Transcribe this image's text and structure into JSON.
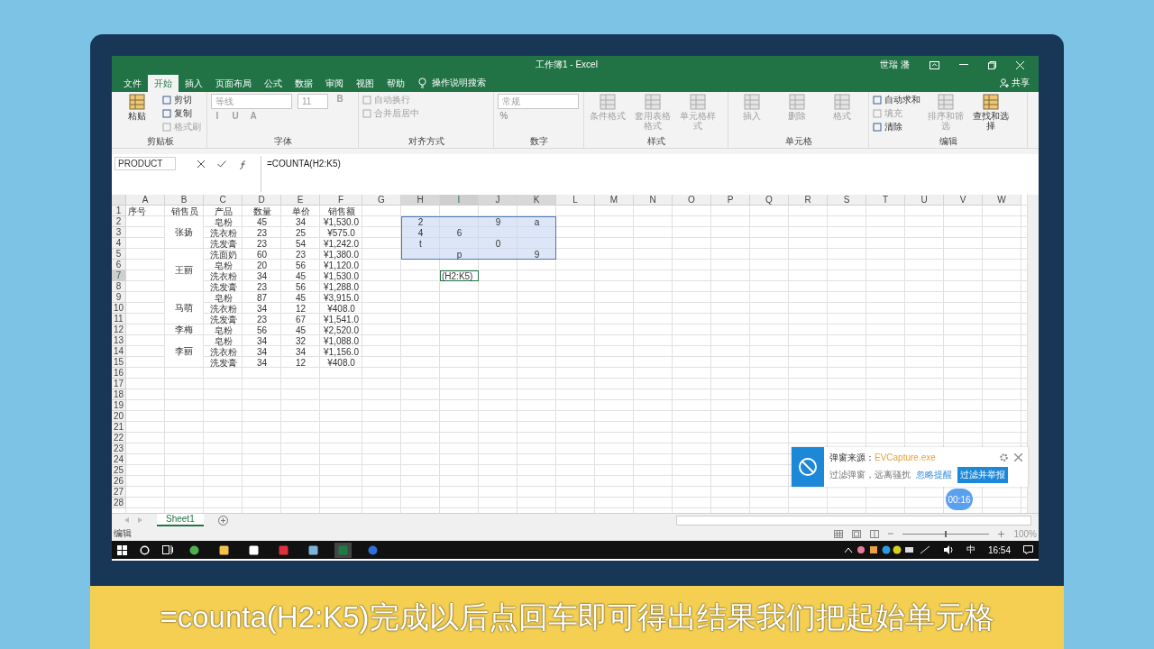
{
  "window": {
    "title": "工作簿1 - Excel",
    "user": "世瑞 潘",
    "share": "共享"
  },
  "ribbon_tabs": [
    {
      "label": "文件",
      "selected": false
    },
    {
      "label": "开始",
      "selected": true
    },
    {
      "label": "插入",
      "selected": false
    },
    {
      "label": "页面布局",
      "selected": false
    },
    {
      "label": "公式",
      "selected": false
    },
    {
      "label": "数据",
      "selected": false
    },
    {
      "label": "审阅",
      "selected": false
    },
    {
      "label": "视图",
      "selected": false
    },
    {
      "label": "帮助",
      "selected": false
    }
  ],
  "tell_me": "操作说明搜索",
  "ribbon_groups": [
    {
      "label": "剪贴板",
      "items": [
        {
          "kind": "large",
          "label": "粘贴",
          "disabled": false
        },
        {
          "kind": "small",
          "label": "剪切",
          "disabled": false
        },
        {
          "kind": "small",
          "label": "复制",
          "disabled": false
        },
        {
          "kind": "small",
          "label": "格式刷",
          "disabled": true
        }
      ]
    },
    {
      "label": "字体",
      "items": [
        {
          "kind": "combo",
          "label": "等线",
          "disabled": true
        },
        {
          "kind": "combo",
          "label": "11",
          "disabled": true
        },
        {
          "kind": "glyph",
          "label": "B",
          "disabled": true
        },
        {
          "kind": "glyph",
          "label": "I",
          "disabled": true
        },
        {
          "kind": "glyph",
          "label": "U",
          "disabled": true
        },
        {
          "kind": "glyph",
          "label": "A",
          "disabled": true
        }
      ]
    },
    {
      "label": "对齐方式",
      "items": [
        {
          "kind": "small",
          "label": "自动换行",
          "disabled": true
        },
        {
          "kind": "small",
          "label": "合并后居中",
          "disabled": true
        }
      ]
    },
    {
      "label": "数字",
      "items": [
        {
          "kind": "combo",
          "label": "常规",
          "disabled": true
        },
        {
          "kind": "glyph",
          "label": "%",
          "disabled": true
        }
      ]
    },
    {
      "label": "样式",
      "items": [
        {
          "kind": "large",
          "label": "条件格式",
          "disabled": true
        },
        {
          "kind": "large",
          "label": "套用表格格式",
          "disabled": true
        },
        {
          "kind": "large",
          "label": "单元格样式",
          "disabled": true
        }
      ]
    },
    {
      "label": "单元格",
      "items": [
        {
          "kind": "large",
          "label": "插入",
          "disabled": true
        },
        {
          "kind": "large",
          "label": "删除",
          "disabled": true
        },
        {
          "kind": "large",
          "label": "格式",
          "disabled": true
        }
      ]
    },
    {
      "label": "编辑",
      "items": [
        {
          "kind": "small",
          "label": "自动求和",
          "disabled": false
        },
        {
          "kind": "small",
          "label": "填充",
          "disabled": true
        },
        {
          "kind": "small",
          "label": "清除",
          "disabled": false
        },
        {
          "kind": "large",
          "label": "排序和筛选",
          "disabled": true
        },
        {
          "kind": "large",
          "label": "查找和选择",
          "disabled": false
        }
      ]
    }
  ],
  "formula_bar": {
    "name_box": "PRODUCT",
    "formula": "=COUNTA(H2:K5)"
  },
  "sheet": {
    "columns": [
      "A",
      "B",
      "C",
      "D",
      "E",
      "F",
      "G",
      "H",
      "I",
      "J",
      "K",
      "L",
      "M",
      "N",
      "O",
      "P",
      "Q",
      "R",
      "S",
      "T",
      "U",
      "V",
      "W"
    ],
    "row_numbers": [
      "1",
      "2",
      "3",
      "4",
      "5",
      "6",
      "7",
      "8",
      "9",
      "10",
      "11",
      "12",
      "13",
      "14",
      "15",
      "16",
      "17",
      "18",
      "19",
      "20",
      "21",
      "22",
      "23",
      "24",
      "25",
      "26",
      "27",
      "28"
    ],
    "header": [
      "序号",
      "销售员",
      "产品",
      "数量",
      "单价",
      "销售额"
    ],
    "groups": [
      {
        "seller": "张扬",
        "items": [
          {
            "product": "皂粉",
            "qty": "45",
            "price": "34",
            "amount": "¥1,530.0"
          },
          {
            "product": "洗衣粉",
            "qty": "23",
            "price": "25",
            "amount": "¥575.0"
          },
          {
            "product": "洗发膏",
            "qty": "23",
            "price": "54",
            "amount": "¥1,242.0"
          }
        ]
      },
      {
        "seller": "王丽",
        "items": [
          {
            "product": "洗面奶",
            "qty": "60",
            "price": "23",
            "amount": "¥1,380.0"
          },
          {
            "product": "皂粉",
            "qty": "20",
            "price": "56",
            "amount": "¥1,120.0"
          },
          {
            "product": "洗衣粉",
            "qty": "34",
            "price": "45",
            "amount": "¥1,530.0"
          },
          {
            "product": "洗发膏",
            "qty": "23",
            "price": "56",
            "amount": "¥1,288.0"
          }
        ]
      },
      {
        "seller": "马萌",
        "items": [
          {
            "product": "皂粉",
            "qty": "87",
            "price": "45",
            "amount": "¥3,915.0"
          },
          {
            "product": "洗衣粉",
            "qty": "34",
            "price": "12",
            "amount": "¥408.0"
          },
          {
            "product": "洗发膏",
            "qty": "23",
            "price": "67",
            "amount": "¥1,541.0"
          }
        ]
      },
      {
        "seller": "李梅",
        "items": [
          {
            "product": "皂粉",
            "qty": "56",
            "price": "45",
            "amount": "¥2,520.0"
          }
        ]
      },
      {
        "seller": "李丽",
        "items": [
          {
            "product": "皂粉",
            "qty": "34",
            "price": "32",
            "amount": "¥1,088.0"
          },
          {
            "product": "洗衣粉",
            "qty": "34",
            "price": "34",
            "amount": "¥1,156.0"
          },
          {
            "product": "洗发膏",
            "qty": "34",
            "price": "12",
            "amount": "¥408.0"
          }
        ]
      }
    ],
    "selection_block": [
      [
        {
          "kind": "value",
          "text": "2"
        },
        {
          "kind": "empty"
        },
        {
          "kind": "value",
          "text": "9"
        },
        {
          "kind": "value",
          "text": "a"
        }
      ],
      [
        {
          "kind": "value",
          "text": "4"
        },
        {
          "kind": "value",
          "text": "6"
        },
        {
          "kind": "empty"
        },
        {
          "kind": "empty"
        }
      ],
      [
        {
          "kind": "value",
          "text": "t"
        },
        {
          "kind": "empty"
        },
        {
          "kind": "value",
          "text": "0"
        },
        {
          "kind": "empty"
        }
      ],
      [
        {
          "kind": "empty"
        },
        {
          "kind": "value",
          "text": "p"
        },
        {
          "kind": "empty"
        },
        {
          "kind": "value",
          "text": "9"
        }
      ]
    ],
    "active_cell_text": "(H2:K5)"
  },
  "sheet_tabs": [
    {
      "label": "Sheet1",
      "selected": true
    }
  ],
  "status_bar": {
    "mode": "编辑",
    "zoom": "100%",
    "zoom_slider": {
      "level": 0.5
    }
  },
  "popup": {
    "source_label": "弹窗来源：",
    "source": "EVCapture.exe",
    "message": "过滤弹窗，远离骚扰",
    "ignore": "忽略提醒",
    "report": "过滤并举报"
  },
  "timer": "00:16",
  "taskbar": {
    "apps": [
      {
        "kind": "chat",
        "selected": false
      },
      {
        "kind": "folder",
        "selected": false
      },
      {
        "kind": "store",
        "selected": false
      },
      {
        "kind": "music",
        "selected": false
      },
      {
        "kind": "tool",
        "selected": false
      },
      {
        "kind": "sheet",
        "selected": true
      },
      {
        "kind": "browser",
        "selected": false
      }
    ],
    "ime": "中",
    "time": "16:54"
  },
  "subtitle": "=counta(H2:K5)完成以后点回车即可得出结果我们把起始单元格"
}
